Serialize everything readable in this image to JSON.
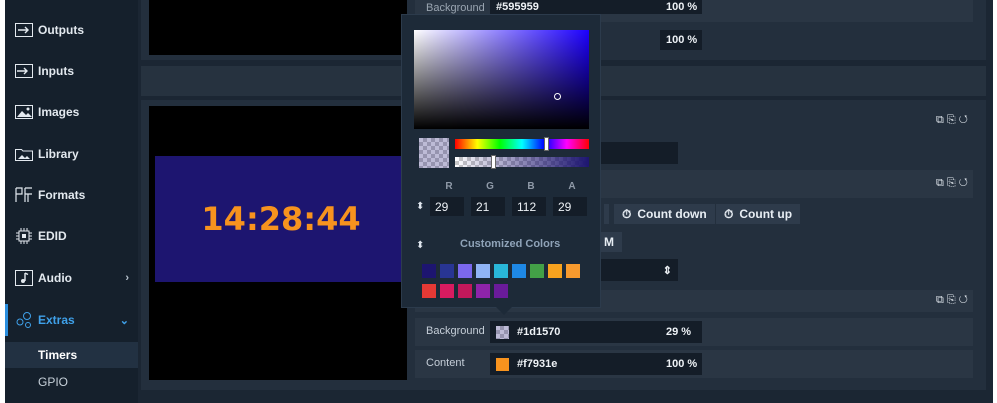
{
  "sidebar": {
    "items": [
      {
        "label": "Outputs",
        "icon": "output-arrow-icon"
      },
      {
        "label": "Inputs",
        "icon": "input-arrow-icon"
      },
      {
        "label": "Images",
        "icon": "image-icon"
      },
      {
        "label": "Library",
        "icon": "folder-image-icon"
      },
      {
        "label": "Formats",
        "icon": "formats-icon"
      },
      {
        "label": "EDID",
        "icon": "chip-icon"
      },
      {
        "label": "Audio",
        "icon": "audio-icon"
      },
      {
        "label": "Extras",
        "icon": "nodes-icon"
      }
    ],
    "sub_items": [
      "Timers",
      "GPIO"
    ]
  },
  "top": {
    "background_label": "Background",
    "background_value": "#595959",
    "background_pct": "100 %",
    "second_pct": "100 %"
  },
  "timer": {
    "display": "14:28:44",
    "count_down_label": "Count down",
    "count_up_label": "Count up",
    "toggle_fragment": "M"
  },
  "bottom": {
    "background_label": "Background",
    "background_value": "#1d1570",
    "background_pct": "29 %",
    "content_label": "Content",
    "content_value": "#f7931e",
    "content_pct": "100 %"
  },
  "picker": {
    "labels": [
      "R",
      "G",
      "B",
      "A"
    ],
    "values": [
      "29",
      "21",
      "112",
      "29"
    ],
    "customized_title": "Customized Colors",
    "swatches": [
      "#1d1570",
      "#283593",
      "#7b68ee",
      "#90b4f5",
      "#29b6d8",
      "#1e88e5",
      "#43a047",
      "#f7a21e",
      "#f79a2e",
      "#e53935",
      "#d81b60",
      "#c2185b",
      "#8e24aa",
      "#6a1b9a"
    ]
  },
  "colors": {
    "accent": "#2a8ede",
    "timer_bg": "#1d1570",
    "timer_fg": "#f7931e"
  }
}
